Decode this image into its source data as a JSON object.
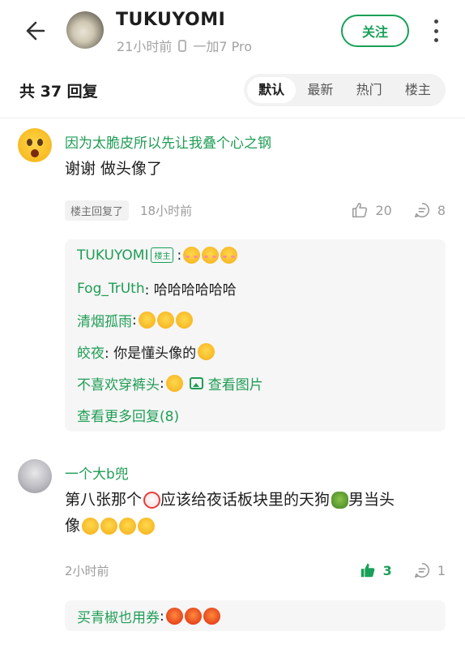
{
  "header": {
    "username": "TUKUYOMI",
    "time": "21小时前",
    "device": "一加7 Pro",
    "follow_label": "关注"
  },
  "reply_bar": {
    "count_text": "共 37 回复",
    "sort_tabs": [
      {
        "label": "默认",
        "active": true
      },
      {
        "label": "最新",
        "active": false
      },
      {
        "label": "热门",
        "active": false
      },
      {
        "label": "楼主",
        "active": false
      }
    ]
  },
  "comments": [
    {
      "author": "因为太脆皮所以先让我叠个心之钢",
      "text": "谢谢 做头像了",
      "tag": "楼主回复了",
      "time": "18小时前",
      "likes": "20",
      "replies": "8",
      "sub_replies": [
        {
          "author": "TUKUYOMI",
          "badge": "楼主",
          "text": ":"
        },
        {
          "author": "Fog_TrUth",
          "text": ": 哈哈哈哈哈哈"
        },
        {
          "author": "清烟孤雨",
          "text": ":"
        },
        {
          "author": "皎夜",
          "text": ": 你是懂头像的"
        },
        {
          "author": "不喜欢穿裤头",
          "text": ":",
          "link": "查看图片"
        }
      ],
      "more_replies": "查看更多回复(8)"
    },
    {
      "author": "一个大b兜",
      "text_part1": "第八张那个",
      "text_part2": "应该给夜话板块里的天狗",
      "text_part3": "男当头",
      "text_part4": "像",
      "time": "2小时前",
      "likes": "3",
      "replies": "1",
      "sub_replies": [
        {
          "author": "买青椒也用券",
          "text": ":"
        }
      ]
    }
  ],
  "colors": {
    "accent": "#19a058",
    "name_green": "#1f9d55",
    "muted": "#9c9c9c",
    "panel": "#f6f6f6"
  }
}
